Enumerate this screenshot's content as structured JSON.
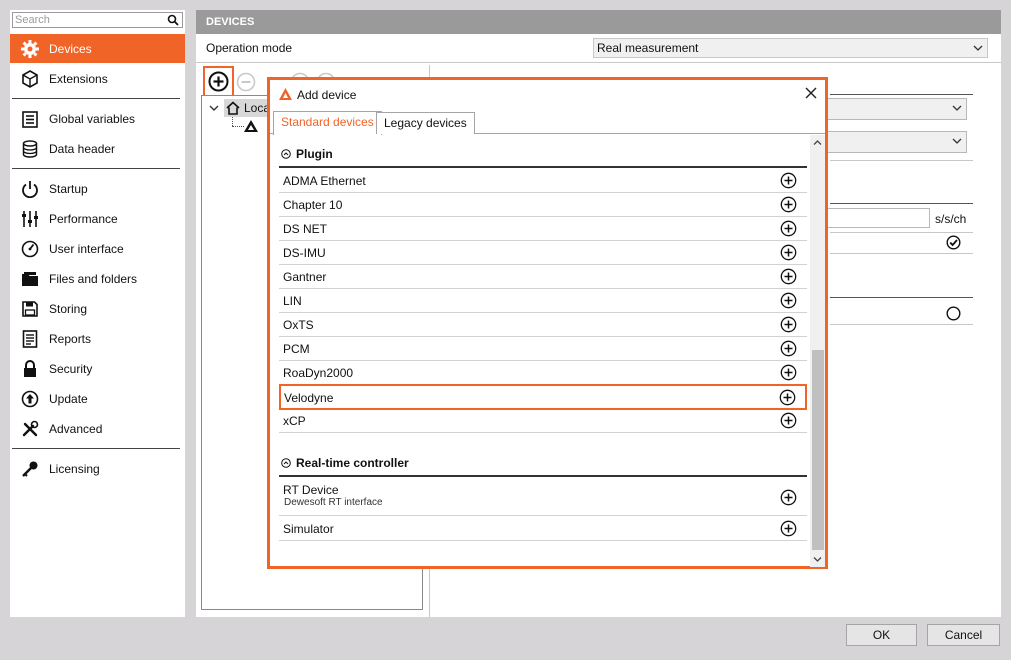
{
  "sidebar": {
    "search_placeholder": "Search",
    "items": [
      {
        "label": "Devices",
        "icon": "gear-icon",
        "active": true
      },
      {
        "label": "Extensions",
        "icon": "cube-icon"
      },
      {
        "label": "Global variables",
        "icon": "variables-icon"
      },
      {
        "label": "Data header",
        "icon": "database-icon"
      },
      {
        "label": "Startup",
        "icon": "power-icon"
      },
      {
        "label": "Performance",
        "icon": "sliders-icon"
      },
      {
        "label": "User interface",
        "icon": "gauge-icon"
      },
      {
        "label": "Files and folders",
        "icon": "folder-icon"
      },
      {
        "label": "Storing",
        "icon": "floppy-icon"
      },
      {
        "label": "Reports",
        "icon": "report-icon"
      },
      {
        "label": "Security",
        "icon": "lock-icon"
      },
      {
        "label": "Update",
        "icon": "update-icon"
      },
      {
        "label": "Advanced",
        "icon": "tools-icon"
      },
      {
        "label": "Licensing",
        "icon": "key-icon"
      }
    ]
  },
  "main": {
    "header": "DEVICES",
    "operation_mode_label": "Operation mode",
    "operation_mode_value": "Real measurement",
    "tree_local_label": "Loca",
    "unit_label": "s/s/ch"
  },
  "dialog": {
    "title": "Add device",
    "tabs": [
      "Standard devices",
      "Legacy devices"
    ],
    "groups": [
      {
        "name": "Plugin",
        "items": [
          {
            "label": "ADMA Ethernet"
          },
          {
            "label": "Chapter 10"
          },
          {
            "label": "DS NET"
          },
          {
            "label": "DS-IMU"
          },
          {
            "label": "Gantner"
          },
          {
            "label": "LIN"
          },
          {
            "label": "OxTS"
          },
          {
            "label": "PCM"
          },
          {
            "label": "RoaDyn2000"
          },
          {
            "label": "Velodyne",
            "highlight": true
          },
          {
            "label": "xCP"
          }
        ]
      },
      {
        "name": "Real-time controller",
        "items": [
          {
            "label": "RT Device",
            "sublabel": "Dewesoft RT interface"
          },
          {
            "label": "Simulator"
          }
        ]
      }
    ]
  },
  "buttons": {
    "ok": "OK",
    "cancel": "Cancel"
  },
  "colors": {
    "accent": "#f06428",
    "header_bg": "#9a9a9a"
  }
}
